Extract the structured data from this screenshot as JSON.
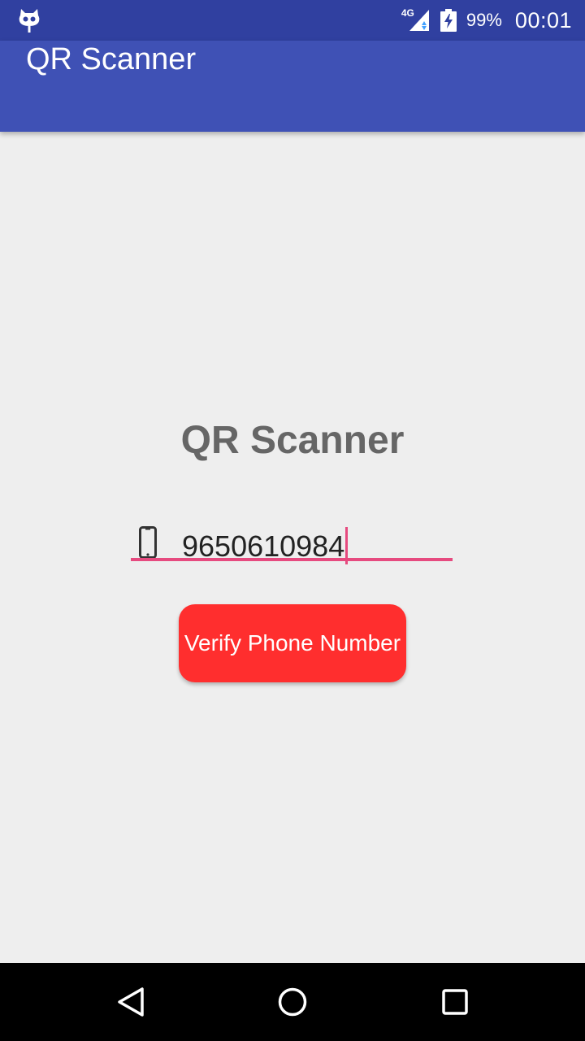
{
  "status_bar": {
    "network_type": "4G",
    "battery_percent": "99%",
    "time": "00:01",
    "icons": [
      "notification-cat-icon",
      "signal-icon",
      "battery-charging-icon"
    ]
  },
  "app_bar": {
    "title": "QR Scanner"
  },
  "main": {
    "heading": "QR Scanner",
    "phone_input": {
      "icon": "smartphone-icon",
      "value": "9650610984"
    },
    "verify_button_label": "Verify Phone Number"
  },
  "nav_bar": {
    "icons": [
      "back-icon",
      "home-icon",
      "recents-icon"
    ]
  },
  "colors": {
    "status_bar": "#3040a0",
    "app_bar": "#3f51b5",
    "background": "#eeeeee",
    "accent": "#e64a7f",
    "button": "#ff2e2e",
    "heading_text": "#666666"
  }
}
